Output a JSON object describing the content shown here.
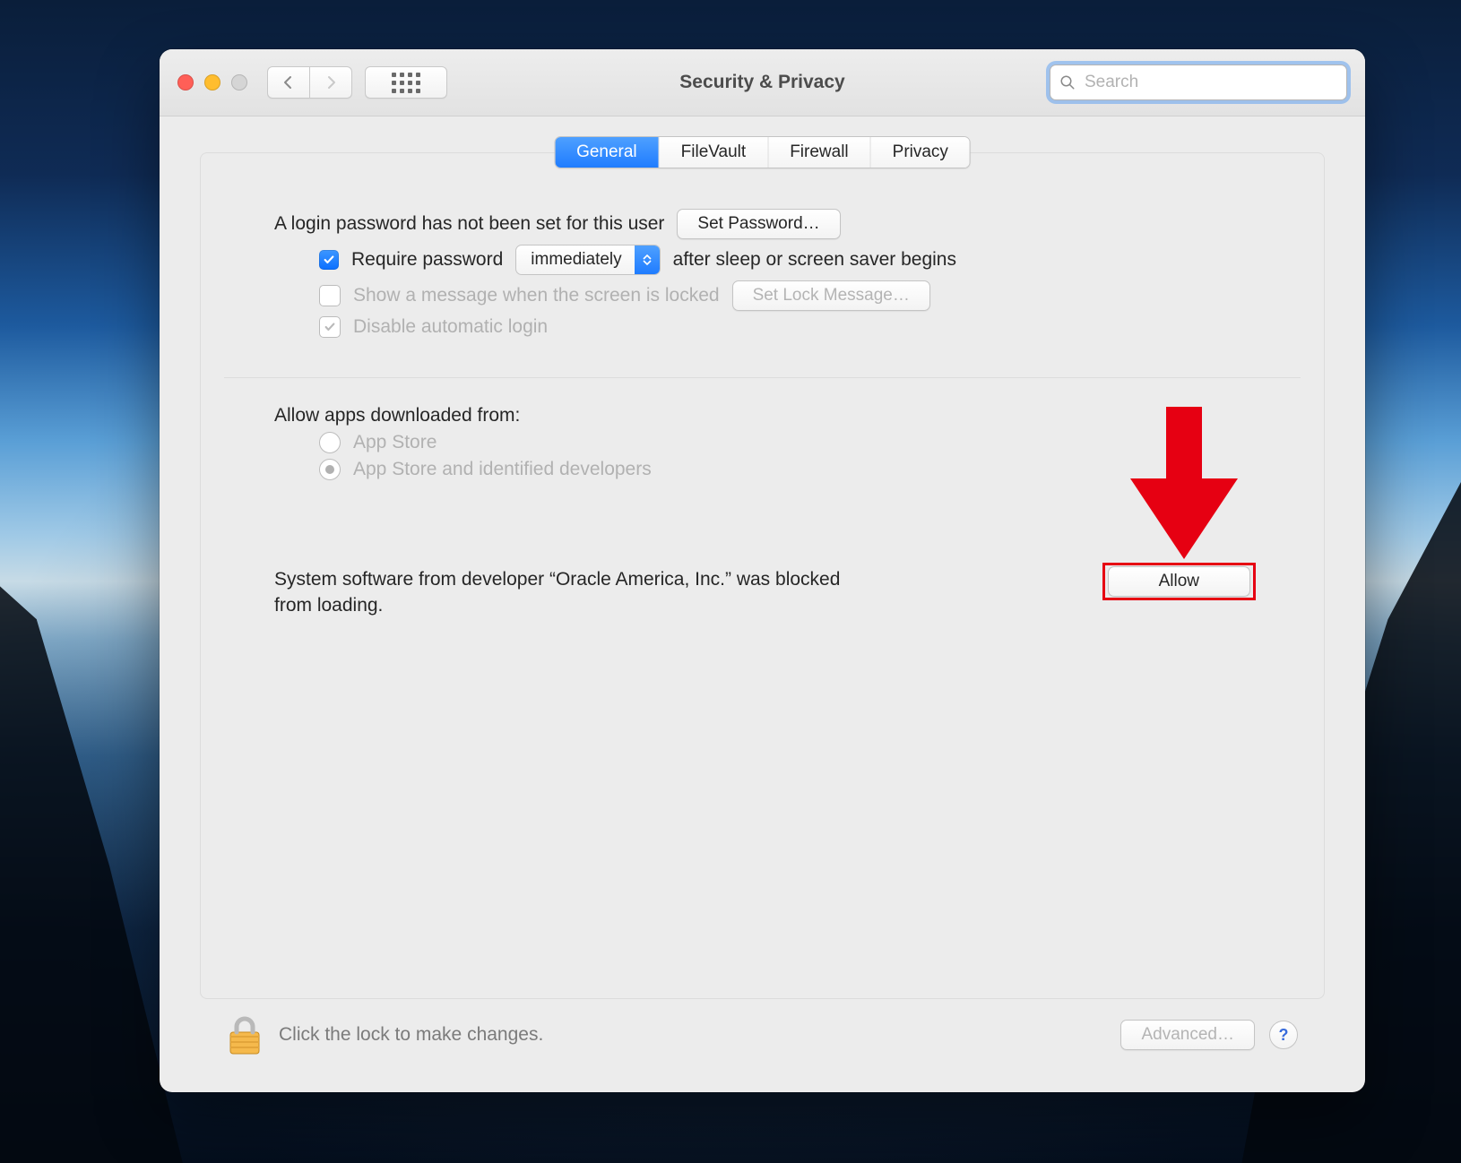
{
  "window": {
    "title": "Security & Privacy",
    "search_placeholder": "Search"
  },
  "tabs": {
    "general": "General",
    "filevault": "FileVault",
    "firewall": "Firewall",
    "privacy": "Privacy"
  },
  "general": {
    "login_password_notice": "A login password has not been set for this user",
    "set_password_button": "Set Password…",
    "require_pw_label_left": "Require password",
    "require_pw_select": "immediately",
    "require_pw_label_right": "after sleep or screen saver begins",
    "show_message_label": "Show a message when the screen is locked",
    "set_lock_message_button": "Set Lock Message…",
    "disable_auto_login_label": "Disable automatic login",
    "allow_apps_heading": "Allow apps downloaded from:",
    "app_store_option": "App Store",
    "app_store_identified_option": "App Store and identified developers",
    "blocked_message": "System software from developer “Oracle America, Inc.” was blocked from loading.",
    "allow_button": "Allow"
  },
  "footer": {
    "lock_hint": "Click the lock to make changes.",
    "advanced_button": "Advanced…",
    "help_label": "?"
  }
}
